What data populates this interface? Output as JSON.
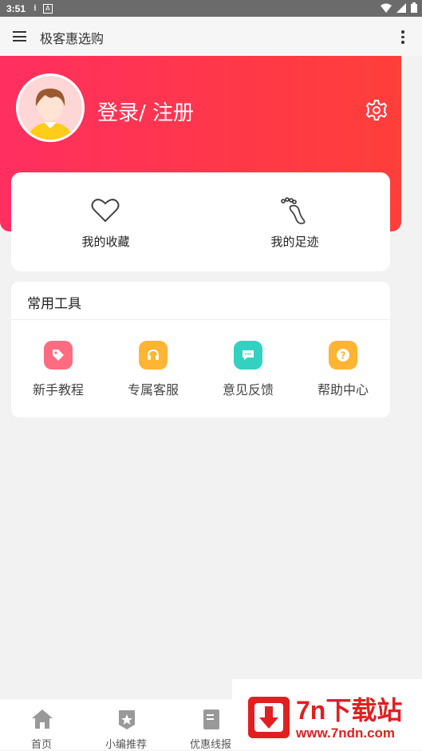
{
  "status_bar": {
    "time": "3:51",
    "download_icon": "download-icon",
    "a_label": "A"
  },
  "app_bar": {
    "title": "极客惠选购",
    "menu_icon": "hamburger-icon",
    "more_icon": "more-vert-icon"
  },
  "header": {
    "login_label": "登录/ 注册",
    "gradient_start": "#ff2f60",
    "gradient_end": "#ff3f3a"
  },
  "quick_links": [
    {
      "label": "我的收藏",
      "icon": "heart-icon"
    },
    {
      "label": "我的足迹",
      "icon": "footprint-icon"
    }
  ],
  "tools": {
    "title": "常用工具",
    "items": [
      {
        "label": "新手教程",
        "icon": "tag-icon",
        "color": "#ff6b81"
      },
      {
        "label": "专属客服",
        "icon": "headset-icon",
        "color": "#ffb433"
      },
      {
        "label": "意见反馈",
        "icon": "chat-icon",
        "color": "#33d1c1"
      },
      {
        "label": "帮助中心",
        "icon": "question-icon",
        "color": "#ffb433"
      }
    ]
  },
  "bottom_nav": [
    {
      "label": "首页",
      "icon": "home-icon"
    },
    {
      "label": "小编推荐",
      "icon": "star-badge-icon"
    },
    {
      "label": "优惠线报",
      "icon": "document-icon"
    }
  ],
  "watermark": {
    "title": "7n下载站",
    "url": "www.7ndn.com"
  }
}
